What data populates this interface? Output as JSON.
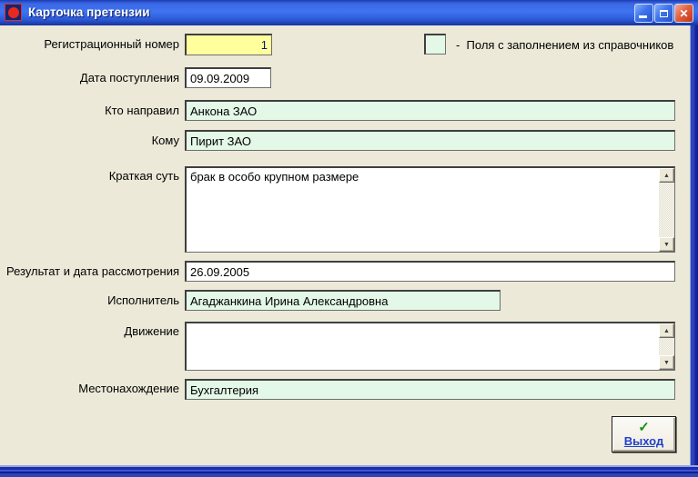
{
  "window": {
    "title": "Карточка претензии"
  },
  "icons": {
    "scroll_up": "▲",
    "scroll_down": "▼",
    "exit_check": "✓",
    "close": "✕"
  },
  "legend": {
    "text": "-  Поля с заполнением из справочников"
  },
  "fields": {
    "reg_number": {
      "label": "Регистрационный номер",
      "value": "1"
    },
    "date_received": {
      "label": "Дата поступления",
      "value": "09.09.2009"
    },
    "sender": {
      "label": "Кто направил",
      "value": "Анкона ЗАО"
    },
    "recipient": {
      "label": "Кому",
      "value": "Пирит ЗАО"
    },
    "summary": {
      "label": "Краткая суть",
      "value": "брак в особо крупном размере"
    },
    "result_date": {
      "label": "Результат и дата рассмотрения",
      "value": "26.09.2005"
    },
    "executor": {
      "label": "Исполнитель",
      "value": "Агаджанкина Ирина Александровна"
    },
    "movement": {
      "label": "Движение",
      "value": ""
    },
    "location": {
      "label": "Местонахождение",
      "value": "Бухгалтерия"
    }
  },
  "buttons": {
    "exit_label": "Выход"
  },
  "colors": {
    "window_background": "#ECE9D8",
    "titlebar_blue": "#3F74F0",
    "highlight_yellow": "#FFFF9C",
    "reference_green": "#E3F8E7",
    "close_button_red": "#D8492A",
    "exit_text_blue": "#1F3FCC",
    "check_green": "#149214",
    "reg_number_text": "#001489"
  }
}
